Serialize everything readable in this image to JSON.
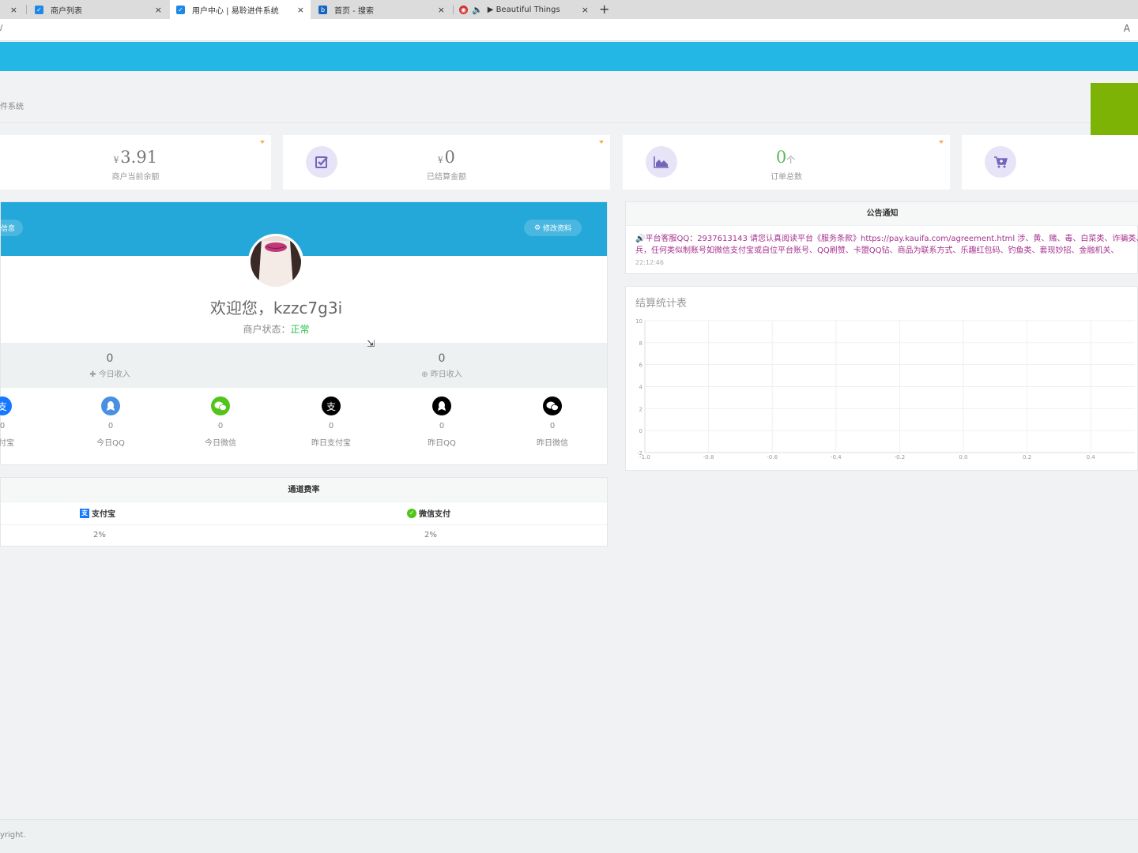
{
  "browser": {
    "tabs": [
      {
        "label": "商户列表",
        "favicon_color": "#1e88e5"
      },
      {
        "label": "用户中心 | 易聆进件系统",
        "favicon_color": "#1e88e5"
      },
      {
        "label": "首页 - 搜索",
        "favicon_color": "#1565c0"
      },
      {
        "label": "▶ Beautiful Things",
        "favicon_color": "#d32f2f"
      }
    ],
    "new_tab": "+",
    "close": "×",
    "url": "/",
    "reader_icon": "A"
  },
  "breadcrumb": "件系统",
  "stats": [
    {
      "currency": "¥",
      "value": "3.91",
      "unit": "",
      "label": "商户当前余额",
      "icon": "wallet-icon"
    },
    {
      "currency": "¥",
      "value": "0",
      "unit": "",
      "label": "已结算金额",
      "icon": "checkbox-icon"
    },
    {
      "currency": "",
      "value": "0",
      "unit": "个",
      "label": "订单总数",
      "icon": "area-chart-icon"
    },
    {
      "currency": "",
      "value": "",
      "unit": "",
      "label": "",
      "icon": "cart-icon"
    }
  ],
  "profile": {
    "info_btn": "信息",
    "edit_btn": "修改资料",
    "welcome": "欢迎您，kzzc7g3i",
    "status_label": "商户状态：",
    "status_value": "正常",
    "today_income": {
      "value": "0",
      "label": "今日收入"
    },
    "yesterday_income": {
      "value": "0",
      "label": "昨日收入"
    },
    "pay": [
      {
        "value": "0",
        "label": "支付宝",
        "color": "#1677ff"
      },
      {
        "value": "0",
        "label": "今日QQ",
        "color": "#4a90e2"
      },
      {
        "value": "0",
        "label": "今日微信",
        "color": "#52c41a"
      },
      {
        "value": "0",
        "label": "昨日支付宝",
        "color": "#000000"
      },
      {
        "value": "0",
        "label": "昨日QQ",
        "color": "#000000"
      },
      {
        "value": "0",
        "label": "昨日微信",
        "color": "#000000"
      }
    ]
  },
  "rates": {
    "title": "通道费率",
    "cols": [
      {
        "name": "支付宝",
        "value": "2%"
      },
      {
        "name": "微信支付",
        "value": "2%"
      }
    ]
  },
  "notice": {
    "title": "公告通知",
    "line1": "平台客服QQ：2937613143 请您认真阅读平台《服务条款》https://pay.kauifa.com/agreement.html 涉、黄、赌、毒、白菜类、诈骗类、飞",
    "line2": "兵，任何类似制账号如微信支付宝或自位平台账号、QQ刷赞、卡盟QQ钻、商品为联系方式、乐趣红包码、钓鱼类、套现妙招、金融机关、",
    "time": "22:12:46"
  },
  "chart_data": {
    "type": "line",
    "title": "结算统计表",
    "x_ticks": [
      "-1.0",
      "-0.8",
      "-0.6",
      "-0.4",
      "-0.2",
      "0.0",
      "0.2",
      "0.4"
    ],
    "y_ticks": [
      "10",
      "8",
      "6",
      "4",
      "2",
      "0",
      "-2"
    ],
    "xlim": [
      -1.0,
      0.4
    ],
    "ylim": [
      -2,
      10
    ],
    "grid": true,
    "series": []
  },
  "footer": "yright."
}
